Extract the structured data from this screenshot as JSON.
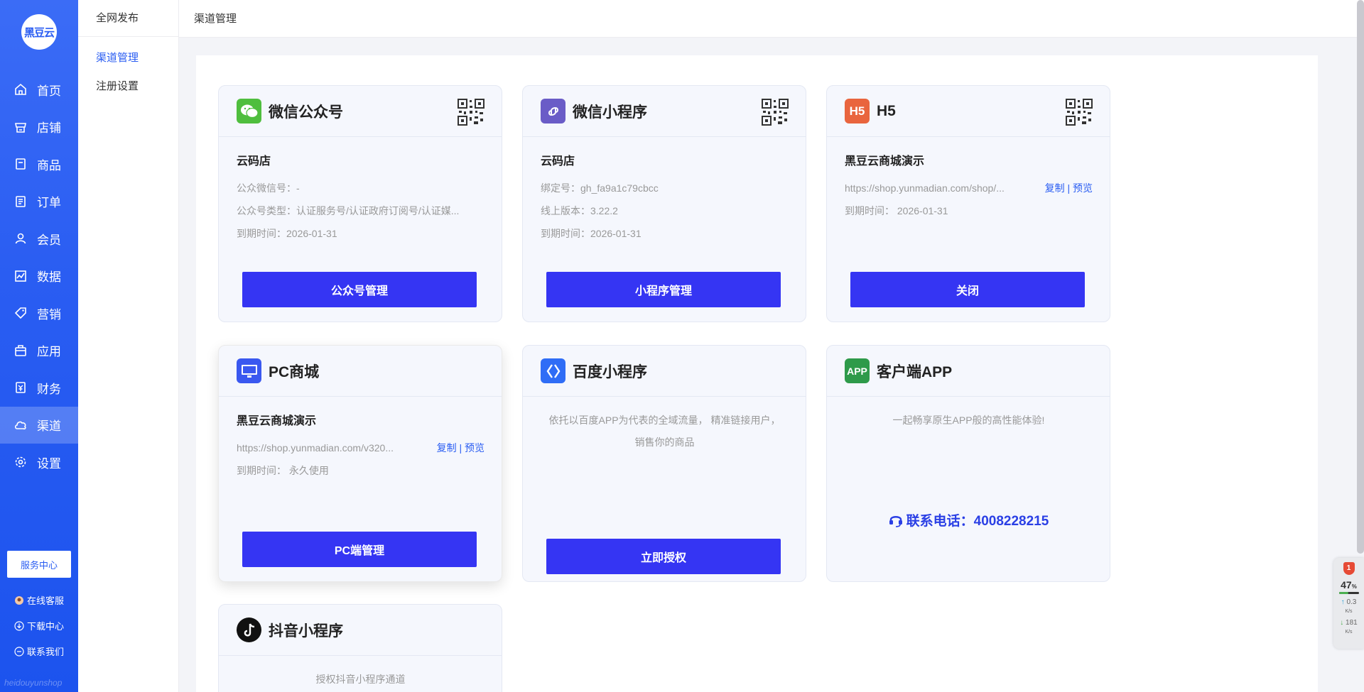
{
  "sidebar": {
    "logo": "黑豆云",
    "nav": [
      {
        "label": "首页",
        "icon": "home-icon"
      },
      {
        "label": "店铺",
        "icon": "store-icon"
      },
      {
        "label": "商品",
        "icon": "goods-icon"
      },
      {
        "label": "订单",
        "icon": "order-icon"
      },
      {
        "label": "会员",
        "icon": "member-icon"
      },
      {
        "label": "数据",
        "icon": "chart-icon"
      },
      {
        "label": "营销",
        "icon": "tag-icon"
      },
      {
        "label": "应用",
        "icon": "app-icon"
      },
      {
        "label": "财务",
        "icon": "finance-icon"
      },
      {
        "label": "渠道",
        "icon": "channel-icon"
      },
      {
        "label": "设置",
        "icon": "gear-icon"
      }
    ],
    "active_index": 9,
    "service_center": "服务中心",
    "links": [
      "在线客服",
      "下载中心",
      "联系我们"
    ],
    "watermark": "heidouyunshop"
  },
  "subside": {
    "head": "全网发布",
    "items": [
      "渠道管理",
      "注册设置"
    ]
  },
  "topbar": {
    "title": "渠道管理"
  },
  "cards": {
    "wechat_oa": {
      "name": "微信公众号",
      "shop": "云码店",
      "rows": [
        "公众微信号：-",
        "公众号类型：认证服务号/认证政府订阅号/认证媒...",
        "到期时间：2026-01-31"
      ],
      "button": "公众号管理"
    },
    "wechat_mp": {
      "name": "微信小程序",
      "shop": "云码店",
      "rows": [
        "绑定号：gh_fa9a1c79cbcc",
        "线上版本：3.22.2",
        "到期时间：2026-01-31"
      ],
      "button": "小程序管理"
    },
    "h5": {
      "name": "H5",
      "shop": "黑豆云商城演示",
      "url": "https://shop.yunmadian.com/shop/...",
      "links": "复制 | 预览",
      "expire": "到期时间：  2026-01-31",
      "button": "关闭"
    },
    "pc": {
      "name": "PC商城",
      "shop": "黑豆云商城演示",
      "url": "https://shop.yunmadian.com/v320...",
      "links": "复制 | 预览",
      "expire": "到期时间：  永久使用",
      "button": "PC端管理"
    },
    "baidu": {
      "name": "百度小程序",
      "desc": "依托以百度APP为代表的全域流量， 精准链接用户，销售你的商品",
      "button": "立即授权"
    },
    "app": {
      "name": "客户端APP",
      "desc": "一起畅享原生APP般的高性能体验!",
      "phone": "联系电话：4008228215"
    },
    "douyin": {
      "name": "抖音小程序",
      "desc": "授权抖音小程序通道"
    }
  },
  "widget": {
    "badge": "1",
    "percent": "47",
    "percent_unit": "%",
    "usage": 0.47,
    "up": "0.3",
    "down": "181",
    "unit": "K/s"
  },
  "colors": {
    "sidebar": "#2a5df2",
    "button": "#3535f3",
    "accent": "#2a5df2"
  }
}
